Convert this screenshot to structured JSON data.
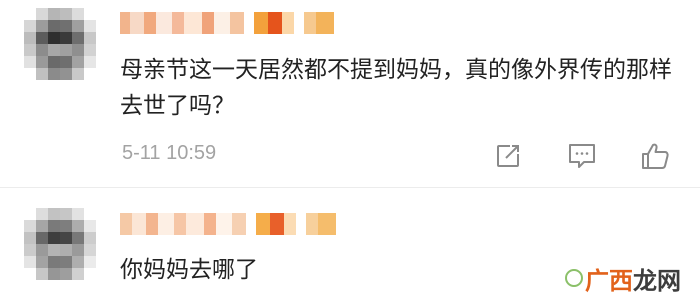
{
  "comments": [
    {
      "text": "母亲节这一天居然都不提到妈妈，真的像外界传的那样去世了吗？",
      "timestamp": "5-11 10:59",
      "actions": [
        "repost-icon",
        "reply-icon",
        "like-icon"
      ]
    },
    {
      "text": "你妈妈去哪了",
      "timestamp": ""
    }
  ],
  "watermark": {
    "part1": "广西",
    "part2": "龙网"
  },
  "colors": {
    "text": "#222222",
    "meta": "#a3a3a3",
    "icon": "#8a8a8a",
    "divider": "#ececec",
    "watermark_orange": "#e2621b",
    "watermark_dark": "#3d3d3d"
  }
}
